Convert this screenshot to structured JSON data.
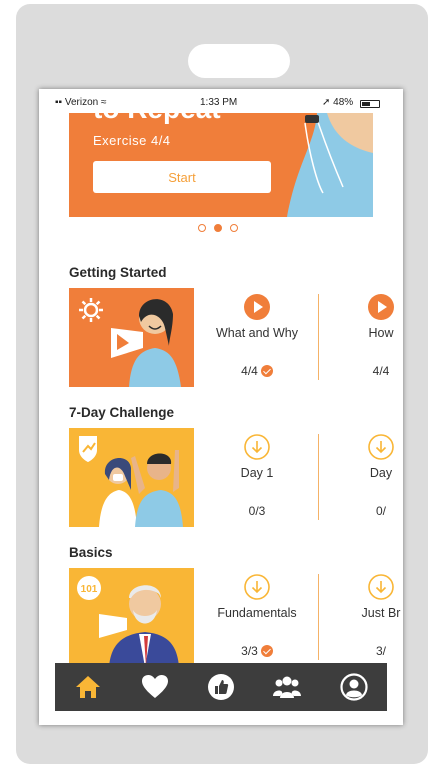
{
  "status_bar": {
    "carrier": "Verizon",
    "time": "1:33 PM",
    "battery": "48%"
  },
  "hero": {
    "title": "to Repeat",
    "subtitle": "Exercise 4/4",
    "start_label": "Start",
    "pager": {
      "count": 3,
      "active_index": 1
    }
  },
  "sections": [
    {
      "title": "Getting Started",
      "cards": [
        {
          "label": "What and Why",
          "progress": "4/4",
          "icon": "play-icon",
          "completed": true
        },
        {
          "label": "How",
          "progress": "4/4",
          "icon": "play-icon",
          "completed": true
        }
      ]
    },
    {
      "title": "7-Day Challenge",
      "cards": [
        {
          "label": "Day 1",
          "progress": "0/3",
          "icon": "download-icon",
          "completed": false
        },
        {
          "label": "Day",
          "progress": "0/",
          "icon": "download-icon",
          "completed": false
        }
      ]
    },
    {
      "title": "Basics",
      "thumb_badge": "101",
      "cards": [
        {
          "label": "Fundamentals",
          "progress": "3/3",
          "icon": "download-icon",
          "completed": true
        },
        {
          "label": "Just Br",
          "progress": "3/",
          "icon": "download-icon",
          "completed": false
        }
      ]
    }
  ],
  "tab_bar": [
    {
      "icon": "home-icon",
      "active": true
    },
    {
      "icon": "heart-icon",
      "active": false
    },
    {
      "icon": "thumbs-up-icon",
      "active": false
    },
    {
      "icon": "group-icon",
      "active": false
    },
    {
      "icon": "profile-icon",
      "active": false
    }
  ],
  "colors": {
    "accent": "#f07e3a",
    "accent_light": "#f5a03a",
    "yellow": "#f9b636",
    "tab_bar": "#3d3d3d",
    "tab_active": "#f9b636"
  }
}
